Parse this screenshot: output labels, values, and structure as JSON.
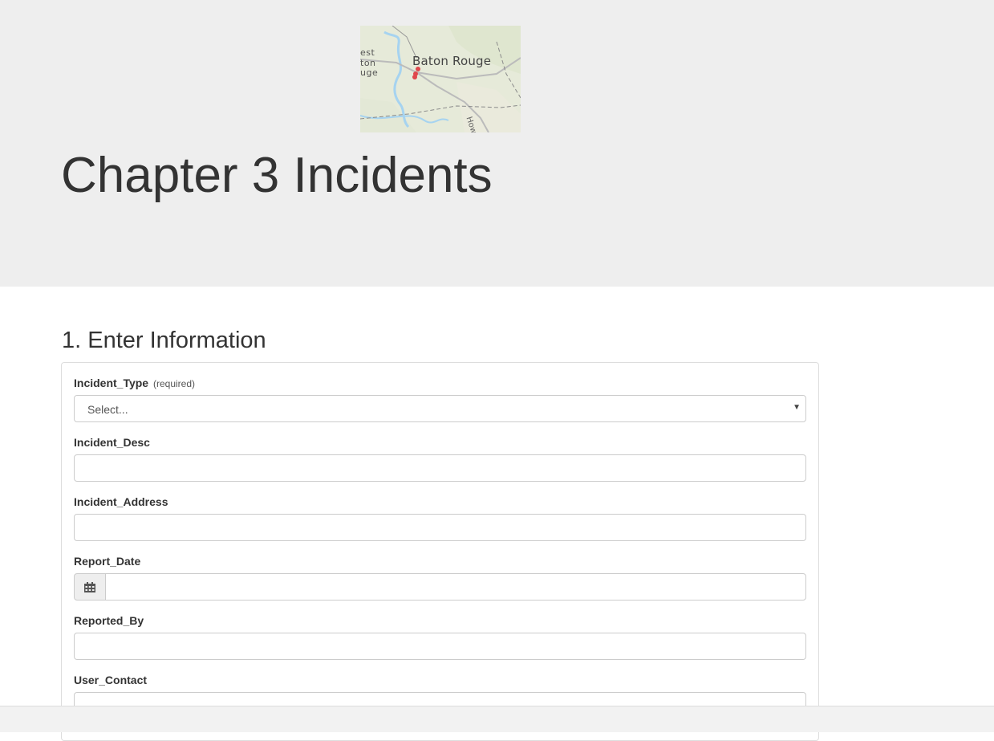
{
  "header": {
    "map": {
      "main_label": "Baton Rouge",
      "partial_labels": [
        "est",
        "ton",
        "uge"
      ],
      "road_label": "How"
    },
    "title": "Chapter 3 Incidents"
  },
  "form": {
    "section_title": "1. Enter Information",
    "fields": {
      "incident_type": {
        "label": "Incident_Type",
        "note": "(required)",
        "value": "Select..."
      },
      "incident_desc": {
        "label": "Incident_Desc",
        "value": ""
      },
      "incident_address": {
        "label": "Incident_Address",
        "value": ""
      },
      "report_date": {
        "label": "Report_Date",
        "value": "",
        "icon": "calendar-icon"
      },
      "reported_by": {
        "label": "Reported_By",
        "value": ""
      },
      "user_contact": {
        "label": "User_Contact",
        "value": ""
      }
    }
  },
  "colors": {
    "hero_background": "#eeeeee",
    "text": "#333333",
    "border": "#cccccc",
    "map_marker": "#e0474c",
    "map_water": "#a6d3f0"
  }
}
